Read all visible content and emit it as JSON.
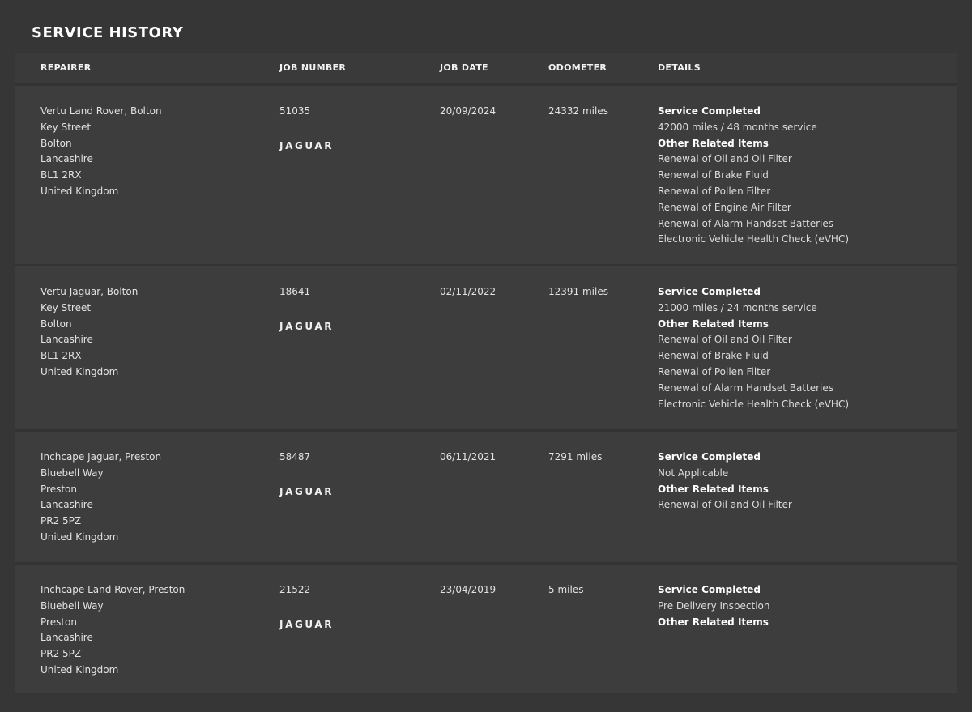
{
  "page": {
    "title": "SERVICE HISTORY"
  },
  "table": {
    "headers": {
      "repairer": "REPAIRER",
      "job_number": "JOB NUMBER",
      "job_date": "JOB DATE",
      "odometer": "ODOMETER",
      "details": "DETAILS"
    },
    "rows": [
      {
        "repairer": [
          "Vertu Land Rover, Bolton",
          "Key Street",
          "Bolton",
          "Lancashire",
          "BL1 2RX",
          "United Kingdom"
        ],
        "job_number": "51035",
        "brand": "JAGUAR",
        "job_date": "20/09/2024",
        "odometer": "24332 miles",
        "details": [
          {
            "text": "Service Completed",
            "strong": true
          },
          {
            "text": "42000 miles / 48 months service",
            "strong": false
          },
          {
            "text": "Other Related Items",
            "strong": true
          },
          {
            "text": "Renewal of Oil and Oil Filter",
            "strong": false
          },
          {
            "text": "Renewal of Brake Fluid",
            "strong": false
          },
          {
            "text": "Renewal of Pollen Filter",
            "strong": false
          },
          {
            "text": "Renewal of Engine Air Filter",
            "strong": false
          },
          {
            "text": "Renewal of Alarm Handset Batteries",
            "strong": false
          },
          {
            "text": "Electronic Vehicle Health Check (eVHC)",
            "strong": false
          }
        ]
      },
      {
        "repairer": [
          "Vertu Jaguar, Bolton",
          "Key Street",
          "Bolton",
          "Lancashire",
          "BL1 2RX",
          "United Kingdom"
        ],
        "job_number": "18641",
        "brand": "JAGUAR",
        "job_date": "02/11/2022",
        "odometer": "12391 miles",
        "details": [
          {
            "text": "Service Completed",
            "strong": true
          },
          {
            "text": "21000 miles / 24 months service",
            "strong": false
          },
          {
            "text": "Other Related Items",
            "strong": true
          },
          {
            "text": "Renewal of Oil and Oil Filter",
            "strong": false
          },
          {
            "text": "Renewal of Brake Fluid",
            "strong": false
          },
          {
            "text": "Renewal of Pollen Filter",
            "strong": false
          },
          {
            "text": "Renewal of Alarm Handset Batteries",
            "strong": false
          },
          {
            "text": "Electronic Vehicle Health Check (eVHC)",
            "strong": false
          }
        ]
      },
      {
        "repairer": [
          "Inchcape Jaguar, Preston",
          "Bluebell Way",
          "Preston",
          "Lancashire",
          "PR2 5PZ",
          "United Kingdom"
        ],
        "job_number": "58487",
        "brand": "JAGUAR",
        "job_date": "06/11/2021",
        "odometer": "7291 miles",
        "details": [
          {
            "text": "Service Completed",
            "strong": true
          },
          {
            "text": "Not Applicable",
            "strong": false
          },
          {
            "text": "Other Related Items",
            "strong": true
          },
          {
            "text": "Renewal of Oil and Oil Filter",
            "strong": false
          }
        ]
      },
      {
        "repairer": [
          "Inchcape Land Rover, Preston",
          "Bluebell Way",
          "Preston",
          "Lancashire",
          "PR2 5PZ",
          "United Kingdom"
        ],
        "job_number": "21522",
        "brand": "JAGUAR",
        "job_date": "23/04/2019",
        "odometer": "5 miles",
        "details": [
          {
            "text": "Service Completed",
            "strong": true
          },
          {
            "text": "Pre Delivery Inspection",
            "strong": false
          },
          {
            "text": "Other Related Items",
            "strong": true
          }
        ]
      }
    ]
  },
  "colors": {
    "background": "#363636",
    "row_background": "#3d3d3d",
    "text": "#e6e6e6",
    "heading": "#ffffff"
  }
}
